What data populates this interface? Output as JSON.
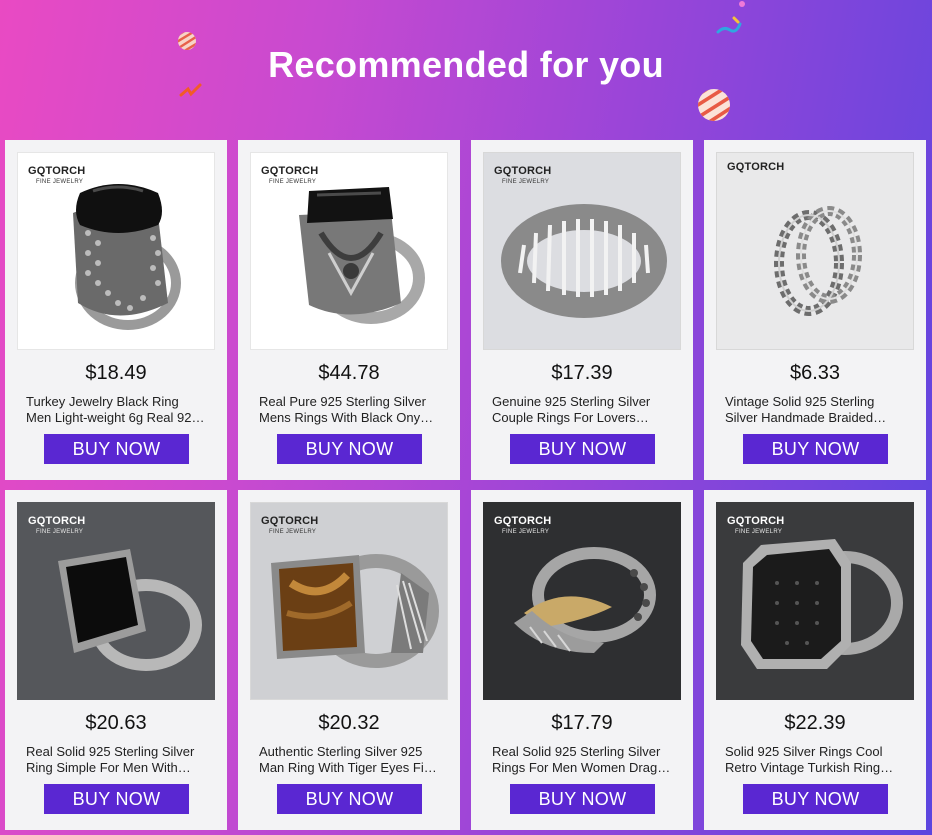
{
  "header": {
    "title": "Recommended for you"
  },
  "colors": {
    "button": "#5a27d2",
    "gradient_left": "#e94ac3",
    "gradient_right": "#5b45df"
  },
  "products": [
    {
      "brand": "GQTORCH",
      "brand_sub": "FINE JEWELRY",
      "price": "$18.49",
      "desc_line1": "Turkey Jewelry Black Ring",
      "desc_line2": "Men Light-weight 6g Real 92…",
      "button": "BUY NOW",
      "image": "black-onyx-dotted-ring"
    },
    {
      "brand": "GQTORCH",
      "brand_sub": "FINE JEWELRY",
      "price": "$44.78",
      "desc_line1": "Real Pure 925 Sterling Silver",
      "desc_line2": "Mens Rings With Black Ony…",
      "button": "BUY NOW",
      "image": "black-stone-ornate-ring"
    },
    {
      "brand": "GQTORCH",
      "brand_sub": "FINE JEWELRY",
      "price": "$17.39",
      "desc_line1": "Genuine 925 Sterling Silver",
      "desc_line2": "Couple Rings For Lovers…",
      "button": "BUY NOW",
      "image": "ribbed-silver-band"
    },
    {
      "brand": "GQTORCH",
      "brand_sub": "",
      "price": "$6.33",
      "desc_line1": "Vintage Solid 925 Sterling",
      "desc_line2": "Silver Handmade Braided…",
      "button": "BUY NOW",
      "image": "braided-silver-ring"
    },
    {
      "brand": "GQTORCH",
      "brand_sub": "FINE JEWELRY",
      "price": "$20.63",
      "desc_line1": "Real Solid 925 Sterling Silver",
      "desc_line2": "Ring Simple For Men With…",
      "button": "BUY NOW",
      "image": "black-square-ring"
    },
    {
      "brand": "GQTORCH",
      "brand_sub": "FINE JEWELRY",
      "price": "$20.32",
      "desc_line1": "Authentic Sterling Silver 925",
      "desc_line2": "Man Ring With Tiger Eyes Fi…",
      "button": "BUY NOW",
      "image": "tiger-eye-ring"
    },
    {
      "brand": "GQTORCH",
      "brand_sub": "FINE JEWELRY",
      "price": "$17.79",
      "desc_line1": "Real Solid 925 Sterling Silver",
      "desc_line2": "Rings For Men Women Drag…",
      "button": "BUY NOW",
      "image": "dragon-claw-ring"
    },
    {
      "brand": "GQTORCH",
      "brand_sub": "FINE JEWELRY",
      "price": "$22.39",
      "desc_line1": "Solid 925 Silver Rings Cool",
      "desc_line2": "Retro Vintage Turkish Ring…",
      "button": "BUY NOW",
      "image": "black-zircon-octagon-ring"
    }
  ]
}
